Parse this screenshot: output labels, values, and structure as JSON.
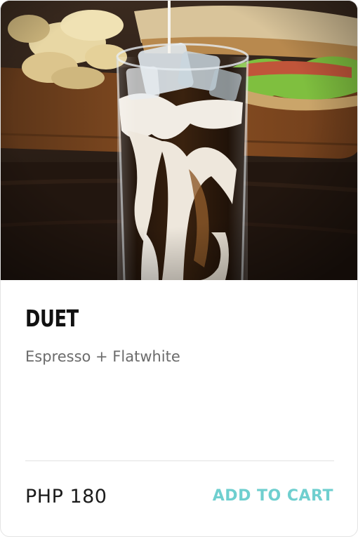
{
  "product": {
    "image_subject": "iced-espresso-latte-photo",
    "name": "DUET",
    "description": "Espresso + Flatwhite",
    "price": "PHP 180",
    "cta_label": "ADD TO CART"
  },
  "colors": {
    "accent": "#6fcfcf",
    "title": "#111111",
    "subtitle": "#6b6b6b",
    "divider": "#e2e2e2"
  }
}
